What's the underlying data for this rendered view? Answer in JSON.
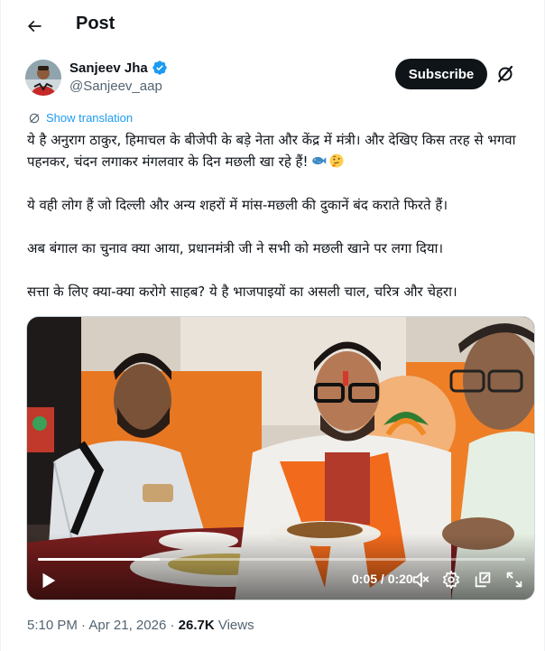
{
  "header": {
    "title": "Post"
  },
  "author": {
    "name": "Sanjeev Jha",
    "handle": "@Sanjeev_aap",
    "verified_color": "#1d9bf0"
  },
  "actions": {
    "subscribe_label": "Subscribe"
  },
  "translation": {
    "label": "Show translation"
  },
  "post": {
    "paragraphs": [
      "ये है अनुराग ठाकुर, हिमाचल के बीजेपी के बड़े नेता और केंद्र में मंत्री। और देखिए किस तरह से भगवा पहनकर, चंदन लगाकर मंगलवार के दिन मछली खा रहे हैं!",
      "ये वही लोग हैं जो दिल्ली और अन्य शहरों में मांस-मछली की दुकानें बंद कराते फिरते हैं।",
      "अब बंगाल का चुनाव क्या आया, प्रधानमंत्री जी ने सभी को मछली खाने पर लगा दिया।",
      "सत्ता के लिए क्या-क्या करोगे साहब? ये है भाजपाइयों का असली चाल, चरित्र और चेहरा।"
    ],
    "emojis": [
      "fish-emoji",
      "thinking-face-emoji"
    ]
  },
  "video": {
    "time": "0:05 / 0:20",
    "progress": 0.25,
    "icons": [
      "play-icon",
      "volume-icon",
      "settings-icon",
      "popout-icon",
      "fullscreen-icon"
    ]
  },
  "meta": {
    "time": "5:10 PM",
    "separator": " · ",
    "date": "Apr 21, 2026",
    "views_count": "26.7K",
    "views_label": " Views"
  },
  "colors": {
    "accent": "#1d9bf0",
    "text": "#0f1419",
    "secondary": "#536471",
    "saffron": "#f26a1b"
  }
}
